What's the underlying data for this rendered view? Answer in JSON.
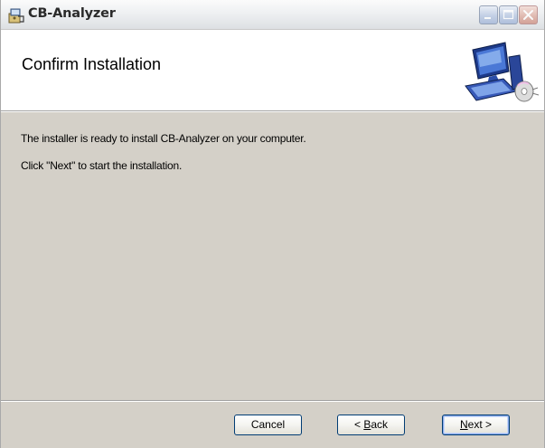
{
  "window": {
    "title": "CB-Analyzer",
    "controls": [
      "minimize",
      "maximize",
      "close"
    ]
  },
  "banner": {
    "title": "Confirm Installation",
    "graphic": "computer-setup-icon"
  },
  "content": {
    "line1": "The installer is ready to install CB-Analyzer on your computer.",
    "line2": "Click \"Next\" to start the installation."
  },
  "buttons": {
    "cancel": "Cancel",
    "back_prefix": "< ",
    "back_mnemonic": "B",
    "back_rest": "ack",
    "next_mnemonic": "N",
    "next_rest": "ext >"
  },
  "colors": {
    "dialog_face": "#d4d0c8",
    "button_border": "#003c74",
    "banner_bg": "#ffffff"
  }
}
